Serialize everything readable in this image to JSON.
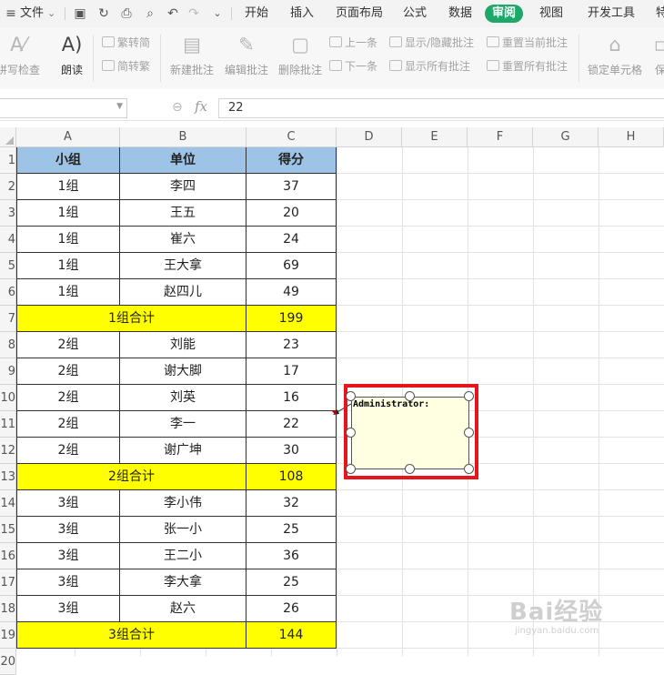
{
  "menubar": {
    "file_label": "文件",
    "tabs": [
      "开始",
      "插入",
      "页面布局",
      "公式",
      "数据",
      "审阅",
      "视图",
      "开发工具",
      "特"
    ],
    "active_tab": "审阅",
    "accent_color": "#1ea76a"
  },
  "ribbon": {
    "spellcheck": "拼写检查",
    "read_aloud": "朗读",
    "to_simplified": "繁转简",
    "to_traditional": "简转繁",
    "new_comment": "新建批注",
    "edit_comment": "编辑批注",
    "delete_comment": "删除批注",
    "prev_comment": "上一条",
    "next_comment": "下一条",
    "toggle_comment": "显示/隐藏批注",
    "show_all_comments": "显示所有批注",
    "reset_current_comment": "重置当前批注",
    "reset_all_comments": "重置所有批注",
    "lock_cell": "锁定单元格",
    "protect": "保"
  },
  "formula_bar": {
    "name_box_value": "",
    "fx_label": "fx",
    "value": "22"
  },
  "columns": [
    "A",
    "B",
    "C",
    "D",
    "E",
    "F",
    "G",
    "H"
  ],
  "rows": [
    "1",
    "2",
    "3",
    "4",
    "5",
    "6",
    "7",
    "8",
    "9",
    "10",
    "11",
    "12",
    "13",
    "14",
    "15",
    "16",
    "17",
    "18",
    "19",
    "20"
  ],
  "table": {
    "headers": [
      "小组",
      "单位",
      "得分"
    ],
    "rows": [
      {
        "group": "1组",
        "unit": "李四",
        "score": "37"
      },
      {
        "group": "1组",
        "unit": "王五",
        "score": "20"
      },
      {
        "group": "1组",
        "unit": "崔六",
        "score": "24"
      },
      {
        "group": "1组",
        "unit": "王大拿",
        "score": "69"
      },
      {
        "group": "1组",
        "unit": "赵四儿",
        "score": "49"
      },
      {
        "subtotal": "1组合计",
        "score": "199"
      },
      {
        "group": "2组",
        "unit": "刘能",
        "score": "23"
      },
      {
        "group": "2组",
        "unit": "谢大脚",
        "score": "17"
      },
      {
        "group": "2组",
        "unit": "刘英",
        "score": "16"
      },
      {
        "group": "2组",
        "unit": "李一",
        "score": "22"
      },
      {
        "group": "2组",
        "unit": "谢广坤",
        "score": "30"
      },
      {
        "subtotal": "2组合计",
        "score": "108"
      },
      {
        "group": "3组",
        "unit": "李小伟",
        "score": "32"
      },
      {
        "group": "3组",
        "unit": "张一小",
        "score": "25"
      },
      {
        "group": "3组",
        "unit": "王二小",
        "score": "36"
      },
      {
        "group": "3组",
        "unit": "李大拿",
        "score": "25"
      },
      {
        "group": "3组",
        "unit": "赵六",
        "score": "26"
      },
      {
        "subtotal": "3组合计",
        "score": "144"
      }
    ],
    "header_color": "#9dc3e6",
    "subtotal_color": "#ffff00"
  },
  "comment": {
    "author": "Administrator:",
    "highlight_color": "#e8141b",
    "fill_color": "#ffffe1"
  },
  "watermark": {
    "brand": "Bai经验",
    "url": "jingyan.baidu.com"
  }
}
